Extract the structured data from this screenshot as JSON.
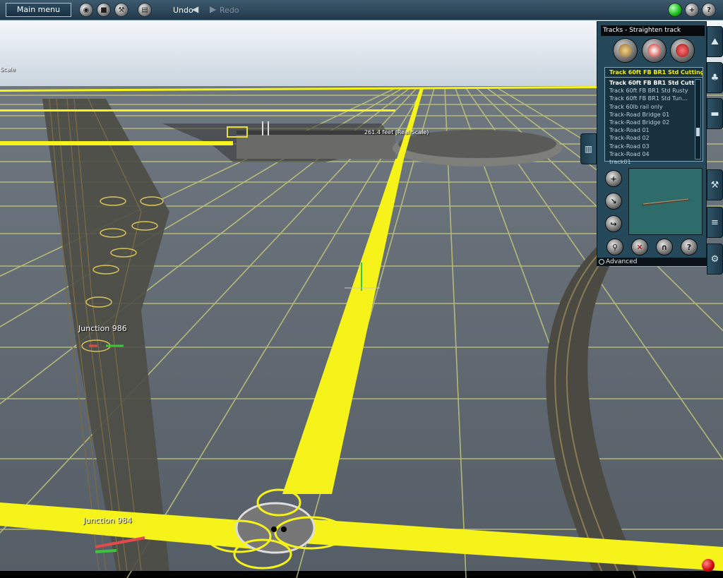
{
  "toolbar": {
    "main_menu": "Main menu",
    "undo": "Undo",
    "redo": "Redo",
    "left_icons": [
      "globe-icon",
      "stop-icon",
      "tools-icon",
      "stack-icon"
    ],
    "right_icons": [
      "online-status-icon",
      "add-icon",
      "help-icon"
    ]
  },
  "panel": {
    "title": "Tracks - Straighten track",
    "selected_item": "Track 60ft FB BR1 Std Cutting",
    "list_items": [
      "Track 60ft FB BR1 Std Cutt...",
      "Track 60ft FB BR1 Std Rusty",
      "Track 60ft FB BR1 Std Tun...",
      "Track 60lb rail only",
      "Track-Road Bridge 01",
      "Track-Road Bridge 02",
      "Track-Road 01",
      "Track-Road 02",
      "Track-Road 03",
      "Track-Road 04",
      "track01"
    ],
    "advanced": "Advanced",
    "tool_icons": [
      "straighten-track-icon",
      "height-adjust-icon",
      "delete-track-icon"
    ],
    "side_tool_icons": [
      "add-spline-icon",
      "bend-track-icon",
      "curve-track-icon"
    ],
    "bottom_tool_icons": [
      "junction-icon",
      "delete-icon",
      "tunnel-icon",
      "help-icon"
    ]
  },
  "side_tabs": [
    "terrain-tab-icon",
    "trees-tab-icon",
    "trains-tab-icon",
    "tools-tab-icon",
    "layers-tab-icon",
    "settings-tab-icon"
  ],
  "scene": {
    "scale_label": "Scale",
    "measure_label": "261.4 feet  (Real Scale)",
    "junction_986": "Junction 986",
    "junction_984": "Junction 984"
  },
  "colors": {
    "grid": "#57616a",
    "grid_lines": "#cfd078",
    "spline": "#f4f21a",
    "sky": "#9fb6c8",
    "panel": "#25485a",
    "toolbar": "#2d4b60"
  }
}
